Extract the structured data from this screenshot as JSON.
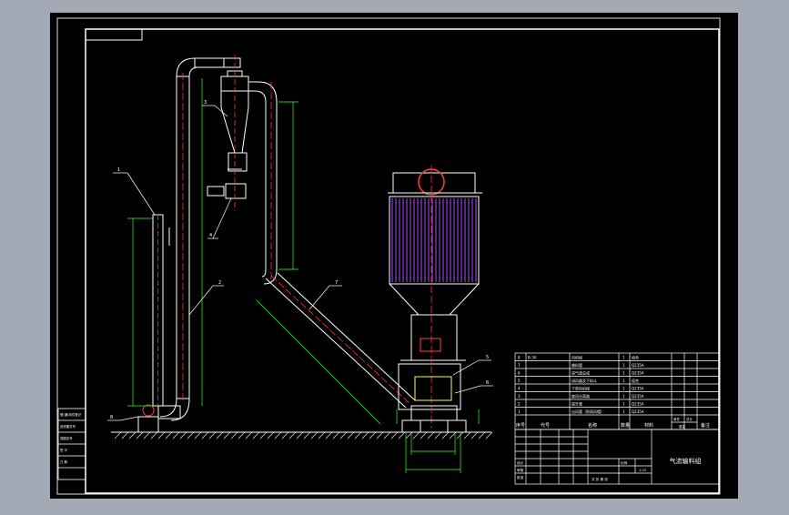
{
  "drawing": {
    "title": "气流输料组",
    "part_callouts": [
      "1",
      "2",
      "3",
      "4",
      "5",
      "6",
      "7",
      "8"
    ],
    "bom": {
      "headers": {
        "seq": "序号",
        "code": "代号",
        "name": "名称",
        "qty": "数量",
        "material": "材料",
        "w1": "单件",
        "w2": "总计",
        "weight": "重量",
        "remark": "备注"
      },
      "rows": [
        {
          "seq": "8",
          "code": "B-3A",
          "name": "风机组",
          "qty": "1",
          "material": "组合"
        },
        {
          "seq": "7",
          "code": "",
          "name": "输料管",
          "qty": "1",
          "material": "Q235A"
        },
        {
          "seq": "6",
          "code": "",
          "name": "进气道总成",
          "qty": "1",
          "material": "Q235A"
        },
        {
          "seq": "5",
          "code": "",
          "name": "闭风器及下料斗",
          "qty": "1",
          "material": "组合"
        },
        {
          "seq": "4",
          "code": "",
          "name": "下部风机组",
          "qty": "1",
          "material": "Q235A"
        },
        {
          "seq": "3",
          "code": "",
          "name": "旋风分离器",
          "qty": "1",
          "material": "Q235A"
        },
        {
          "seq": "2",
          "code": "",
          "name": "提升管",
          "qty": "1",
          "material": "Q235A"
        },
        {
          "seq": "1",
          "code": "",
          "name": "出风管（防雨风帽）",
          "qty": "1",
          "material": "Q235A"
        }
      ]
    },
    "title_block": {
      "scale_label": "比例",
      "scale": "1:25",
      "sheet_label": "共 张 第 张",
      "design": "设计",
      "check": "审核",
      "approve": "批准"
    },
    "side_stamp": [
      "借(通)用件登记",
      "旧底图总号",
      "底图总号",
      "签 字",
      "日 期"
    ]
  }
}
